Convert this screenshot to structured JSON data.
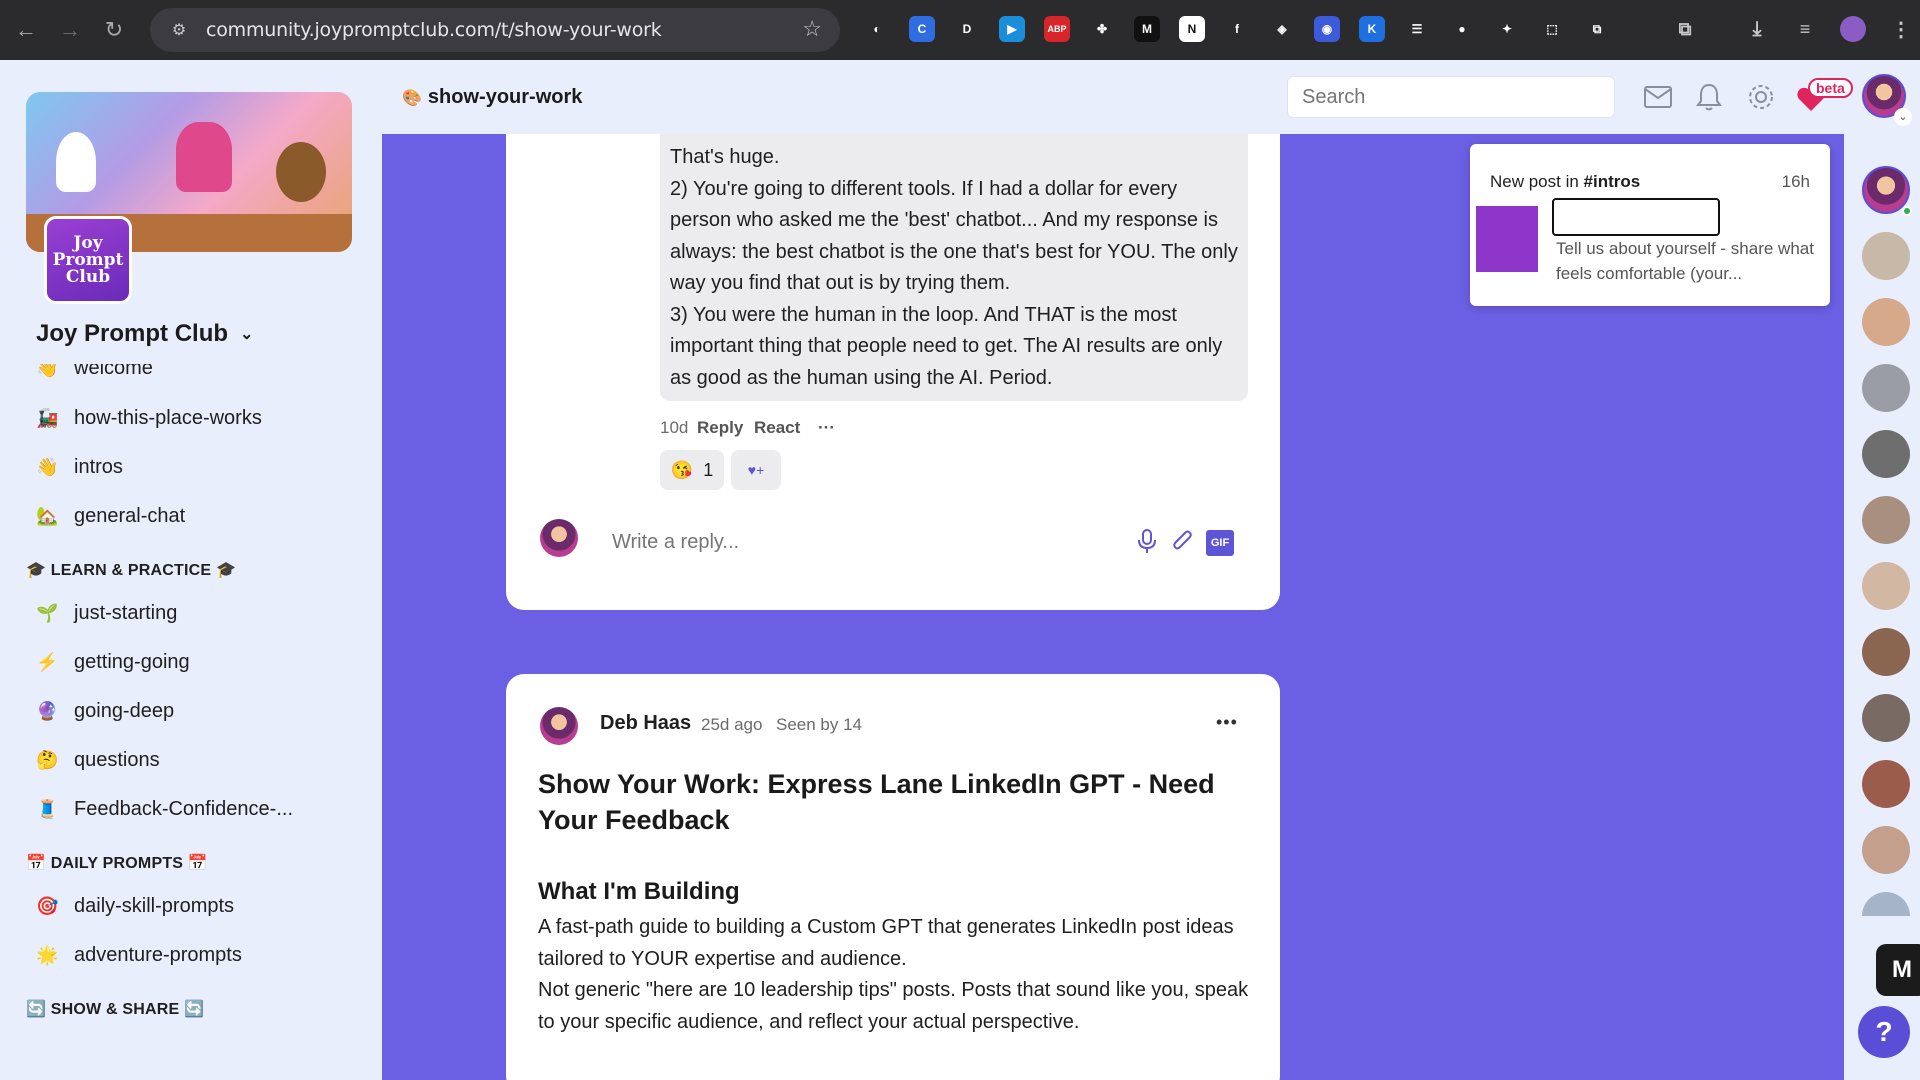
{
  "browser": {
    "url": "community.joypromptclub.com/t/show-your-work",
    "extensions": [
      {
        "name": "copilot-ext-icon",
        "bg": "#2b2b2e",
        "glyph": "◐"
      },
      {
        "name": "edge-ext-icon",
        "bg": "#2f6de1",
        "glyph": "C"
      },
      {
        "name": "d-ext-icon",
        "bg": "#2b2b2e",
        "glyph": "D"
      },
      {
        "name": "play-ext-icon",
        "bg": "#1a8ed8",
        "glyph": "▶"
      },
      {
        "name": "abp-ext-icon",
        "bg": "#d7262a",
        "glyph": "ABP"
      },
      {
        "name": "clover-ext-icon",
        "bg": "#2b2b2e",
        "glyph": "✤"
      },
      {
        "name": "m-ext-icon",
        "bg": "#111111",
        "glyph": "M"
      },
      {
        "name": "notion-ext-icon",
        "bg": "#ffffff",
        "glyph": "N"
      },
      {
        "name": "fx-ext-icon",
        "bg": "#2b2b2e",
        "glyph": "f"
      },
      {
        "name": "layers-ext-icon",
        "bg": "#2b2b2e",
        "glyph": "◈"
      },
      {
        "name": "flag-ext-icon",
        "bg": "#3b5bdb",
        "glyph": "◉"
      },
      {
        "name": "k-ext-icon",
        "bg": "#1e6fe0",
        "glyph": "K"
      },
      {
        "name": "list-ext-icon",
        "bg": "#2b2b2e",
        "glyph": "☰"
      },
      {
        "name": "cookie-ext-icon",
        "bg": "#2b2b2e",
        "glyph": "●"
      },
      {
        "name": "bird-ext-icon",
        "bg": "#2b2b2e",
        "glyph": "✦"
      },
      {
        "name": "screenshot-ext-icon",
        "bg": "#2b2b2e",
        "glyph": "⬚"
      },
      {
        "name": "puzzle-ext-icon",
        "bg": "#2b2b2e",
        "glyph": "⧉"
      }
    ]
  },
  "header": {
    "channel_emoji": "🎨",
    "channel_title": "show-your-work",
    "search_placeholder": "Search",
    "beta_badge": "beta"
  },
  "sidebar": {
    "logo_text": "Joy Prompt Club",
    "community_name": "Joy Prompt Club",
    "items_top": [
      {
        "icon": "👋",
        "label": "welcome"
      },
      {
        "icon": "🚂",
        "label": "how-this-place-works"
      },
      {
        "icon": "👋",
        "label": "intros"
      },
      {
        "icon": "🏡",
        "label": "general-chat"
      }
    ],
    "section_learn": "🎓 LEARN & PRACTICE 🎓",
    "items_learn": [
      {
        "icon": "🌱",
        "label": "just-starting"
      },
      {
        "icon": "⚡",
        "label": "getting-going"
      },
      {
        "icon": "🔮",
        "label": "going-deep"
      },
      {
        "icon": "🤔",
        "label": "questions"
      },
      {
        "icon": "🧵",
        "label": "Feedback-Confidence-..."
      }
    ],
    "section_daily": "📅 DAILY PROMPTS 📅",
    "items_daily": [
      {
        "icon": "🎯",
        "label": "daily-skill-prompts"
      },
      {
        "icon": "🌟",
        "label": "adventure-prompts"
      }
    ],
    "section_show": "🔄 SHOW & SHARE 🔄"
  },
  "comment": {
    "paragraphs": [
      "That's huge.",
      "2) You're going to different tools. If I had a dollar for every person who asked me the 'best' chatbot... And my response is always: the best chatbot is the one that's best for YOU. The only way you find that out is by trying them.",
      "3) You were the human in the loop. And THAT is the most important thing that people need to get. The AI results are only as good as the human using the AI. Period."
    ],
    "age": "10d",
    "reply_label": "Reply",
    "react_label": "React",
    "more_label": "···",
    "reaction_emoji": "😘",
    "reaction_count": "1",
    "add_reaction_glyph": "♥+",
    "reply_placeholder": "Write a reply...",
    "gif_label": "GIF"
  },
  "post": {
    "author": "Deb Haas",
    "age": "25d ago",
    "seen": "Seen by 14",
    "more_label": "•••",
    "title": "Show Your Work: Express Lane LinkedIn GPT - Need Your Feedback",
    "heading": "What I'm Building",
    "body": [
      "A fast-path guide to building a Custom GPT that generates LinkedIn post ideas tailored to YOUR expertise and audience.",
      "Not generic \"here are 10 leadership tips\" posts. Posts that sound like you, speak to your specific audience, and reflect your actual perspective."
    ]
  },
  "notification": {
    "prefix": "New post in ",
    "channel": "#intros",
    "time": "16h",
    "preview": "Tell us about yourself - share what feels comfortable (your..."
  },
  "colors": {
    "accent": "#6b5fe3",
    "sidebar_bg": "#e9eefc",
    "help": "#5b4ed6"
  }
}
